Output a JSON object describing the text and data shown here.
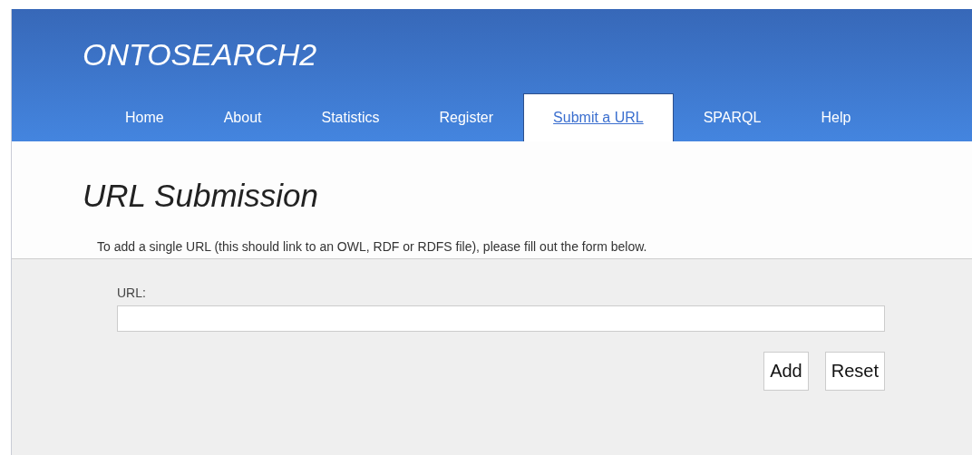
{
  "site_title": "ONTOSEARCH2",
  "nav": [
    {
      "label": "Home",
      "selected": false
    },
    {
      "label": "About",
      "selected": false
    },
    {
      "label": "Statistics",
      "selected": false
    },
    {
      "label": "Register",
      "selected": false
    },
    {
      "label": "Submit a URL",
      "selected": true
    },
    {
      "label": "SPARQL",
      "selected": false
    },
    {
      "label": "Help",
      "selected": false
    }
  ],
  "heading": "URL Submission",
  "intro": "To add a single URL (this should link to an OWL, RDF or RDFS file), please fill out the form below.",
  "form": {
    "field_label": "URL:",
    "buttons": [
      "Add",
      "Reset"
    ]
  }
}
